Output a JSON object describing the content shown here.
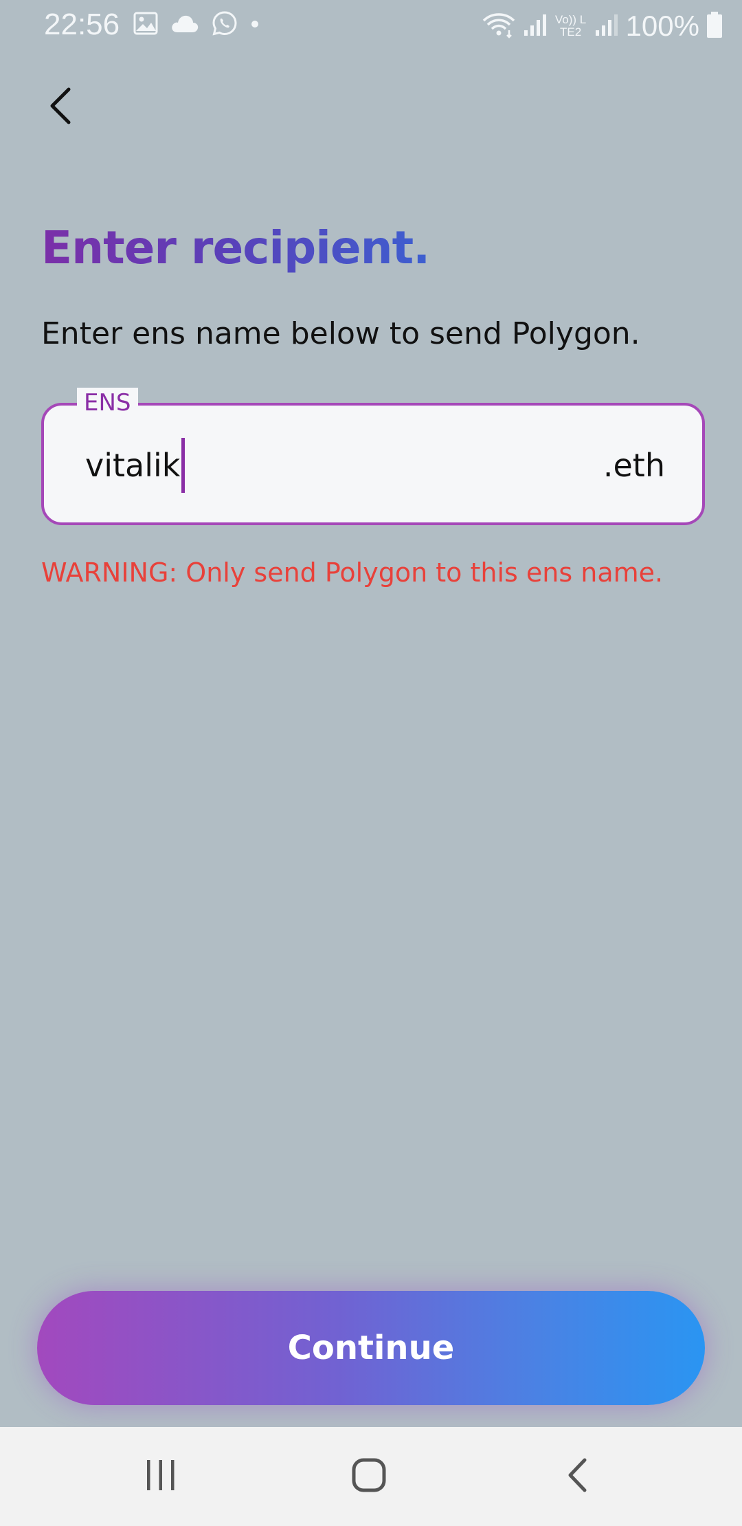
{
  "status_bar": {
    "time": "22:56",
    "battery_percent": "100%",
    "icons_left": [
      "gallery-icon",
      "cloud-icon",
      "whatsapp-icon",
      "dot-icon"
    ],
    "icons_right": [
      "wifi-icon",
      "signal-icon",
      "volte-icon",
      "signal-icon",
      "battery-icon"
    ],
    "volte_label": "Vo)) LTE2"
  },
  "header": {
    "back_icon": "chevron-left-icon"
  },
  "main": {
    "title": "Enter recipient.",
    "subtitle": "Enter ens name below to send Polygon.",
    "ens_field": {
      "label": "ENS",
      "value": "vitalik",
      "suffix": ".eth"
    },
    "warning": "WARNING: Only send Polygon to this ens name."
  },
  "continue_button": {
    "label": "Continue"
  },
  "nav_bar": {
    "icons": [
      "recent-apps-icon",
      "home-icon",
      "back-icon"
    ]
  },
  "colors": {
    "background": "#b1bdc4",
    "accent": "#a548b8",
    "warning": "#e8413a",
    "button_gradient_start": "#a249be",
    "button_gradient_end": "#2a95f2"
  }
}
